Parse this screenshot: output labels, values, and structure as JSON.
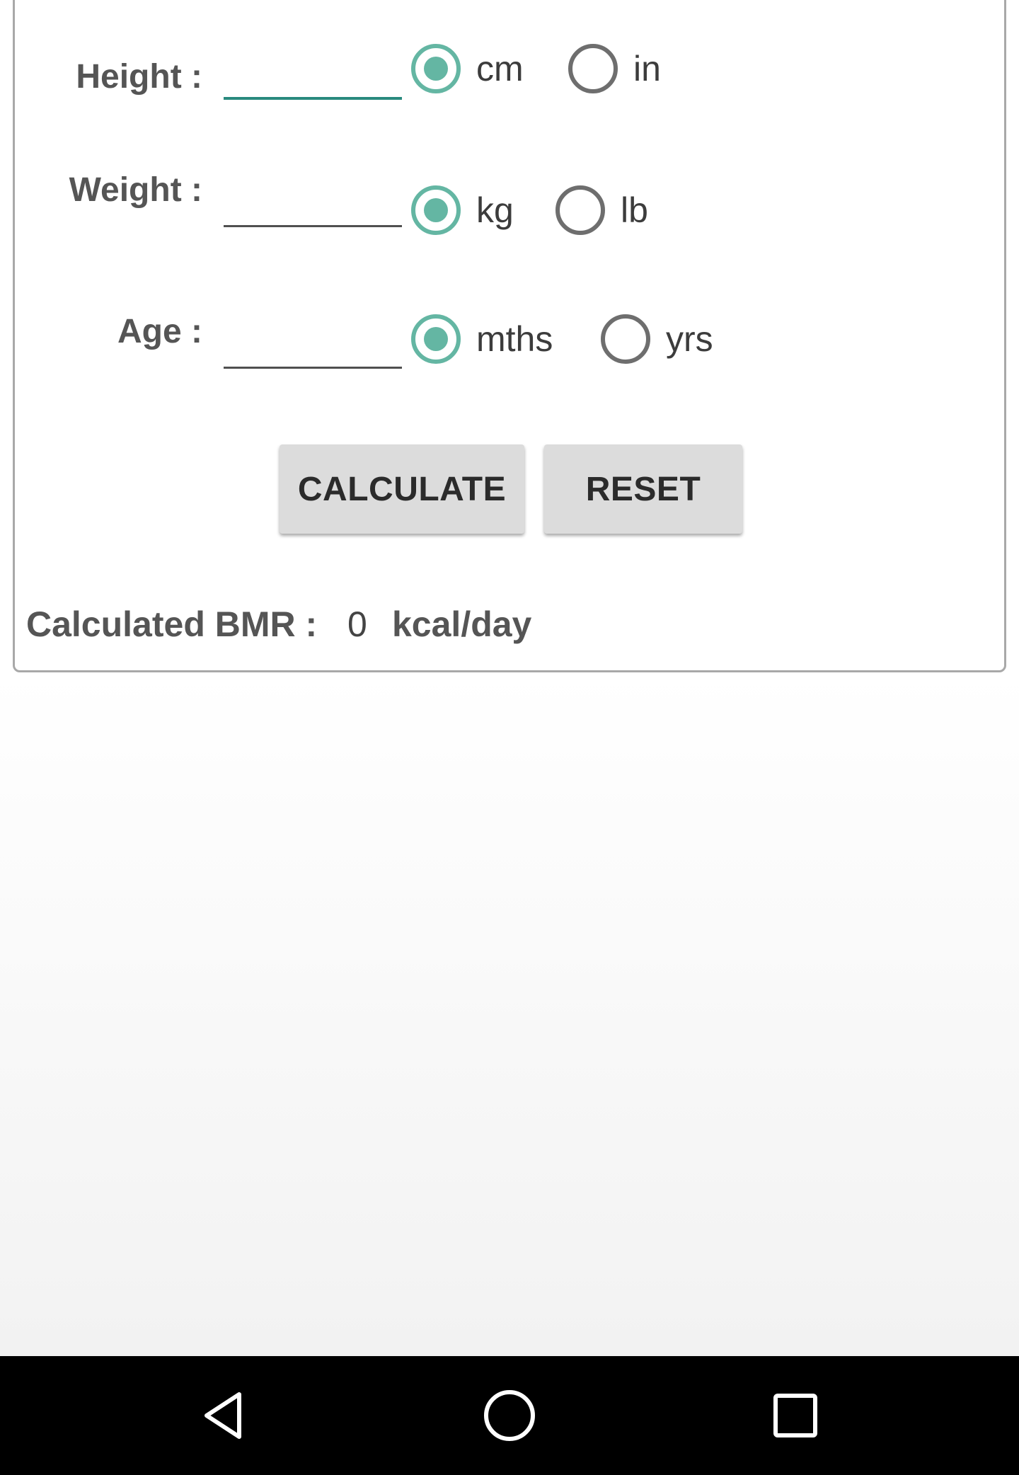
{
  "form": {
    "height_label": "Height :",
    "weight_label": "Weight :",
    "age_label": "Age :",
    "height_value": "",
    "weight_value": "",
    "age_value": "",
    "height_units": [
      "cm",
      "in"
    ],
    "weight_units": [
      "kg",
      "lb"
    ],
    "age_units": [
      "mths",
      "yrs"
    ],
    "height_unit_selected": "cm",
    "weight_unit_selected": "kg",
    "age_unit_selected": "mths"
  },
  "buttons": {
    "calculate_label": "CALCULATE",
    "reset_label": "RESET"
  },
  "result": {
    "label": "Calculated BMR :",
    "value": "0",
    "unit": "kcal/day"
  },
  "navbar": {
    "icons": [
      "back-icon",
      "home-icon",
      "recents-icon"
    ]
  },
  "colors": {
    "accent": "#64b6a3",
    "field_focus": "#2a8a7e",
    "button_bg": "#dcdcdc",
    "navbar_bg": "#000000"
  }
}
